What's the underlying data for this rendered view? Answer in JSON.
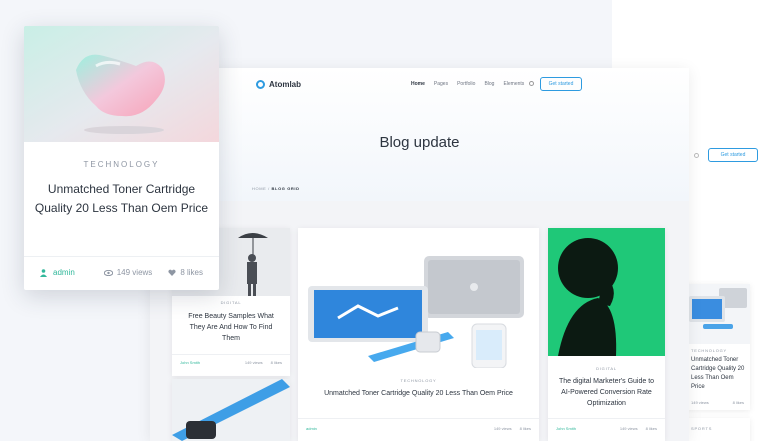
{
  "app": {
    "name": "Atomlab"
  },
  "nav": {
    "items": [
      "Home",
      "Pages",
      "Portfolio",
      "Blog",
      "Elements"
    ],
    "cta": "Get started"
  },
  "hero": {
    "title": "Blog update",
    "breadcrumb": {
      "home": "Home",
      "current": "Blog grid"
    }
  },
  "cards": [
    {
      "category": "Digital",
      "title": "Free Beauty Samples What They Are And How To Find Them",
      "author": "John Smith",
      "views": "149 views",
      "likes": "8 likes"
    },
    {
      "category": "Technology",
      "title": "Unmatched Toner Cartridge Quality 20 Less Than Oem Price",
      "author": "admin",
      "views": "149 views",
      "likes": "8 likes"
    },
    {
      "category": "Digital",
      "title": "The digital Marketer's Guide to AI-Powered Conversion Rate Optimization",
      "author": "John Smith",
      "views": "149 views",
      "likes": "8 likes"
    }
  ],
  "popup": {
    "category": "TECHNOLOGY",
    "title": "Unmatched Toner Cartridge Quality 20 Less Than Oem Price",
    "author": "admin",
    "views": "149 views",
    "likes": "8 likes"
  },
  "back": {
    "cta": "Get started",
    "card": {
      "category": "Technology",
      "title": "Unmatched Toner Cartridge Quality 20 Less Than Oem Price",
      "views": "149 views",
      "likes": "8 likes"
    },
    "card2": {
      "category": "Sports"
    }
  },
  "colors": {
    "accent": "#2e9be0",
    "author": "#32b89b",
    "card_green": "#1fc878"
  }
}
